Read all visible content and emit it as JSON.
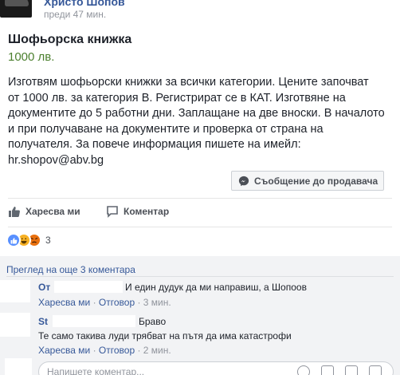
{
  "post": {
    "author": "Христо Шопов",
    "timestamp": "преди 47 мин.",
    "title": "Шофьорска книжка",
    "price": "1000 лв.",
    "description": "Изготвям шофьорски книжки за всички категории. Цените започват\nот 1000 лв. за категория В. Регистрират се в КАТ. Изготвяне на\nдокументите до 5 работни дни. Заплащане на две вноски. В началото\nи при получаване на документите и проверка от страна на\nполучателя. За повече информация пишете на имейл:\nhr.shopov@abv.bg",
    "message_seller_label": "Съобщение до продавача"
  },
  "actions": {
    "like_label": "Харесва ми",
    "comment_label": "Коментар"
  },
  "reactions": {
    "types": [
      "like",
      "haha",
      "angry"
    ],
    "count": "3"
  },
  "comments_section": {
    "view_more": "Преглед на още 3 коментара",
    "comments": [
      {
        "author": "От",
        "text": "И един дудук да ми направиш, а Шопоов",
        "like_link": "Харесва ми",
        "reply_link": "Отговор",
        "time": "3 мин."
      },
      {
        "author": "St",
        "text_line1": "Браво",
        "text_line2": "Те само такива луди трябват на пътя да има катастрофи",
        "like_link": "Харесва ми",
        "reply_link": "Отговор",
        "time": "2 мин."
      }
    ],
    "reply_placeholder": "Напишете коментар..."
  },
  "colors": {
    "link": "#365899",
    "price": "#4b7f2e",
    "like_reaction": "#5890ff",
    "haha_reaction": "#f7b125",
    "angry_reaction": "#e9710f"
  }
}
